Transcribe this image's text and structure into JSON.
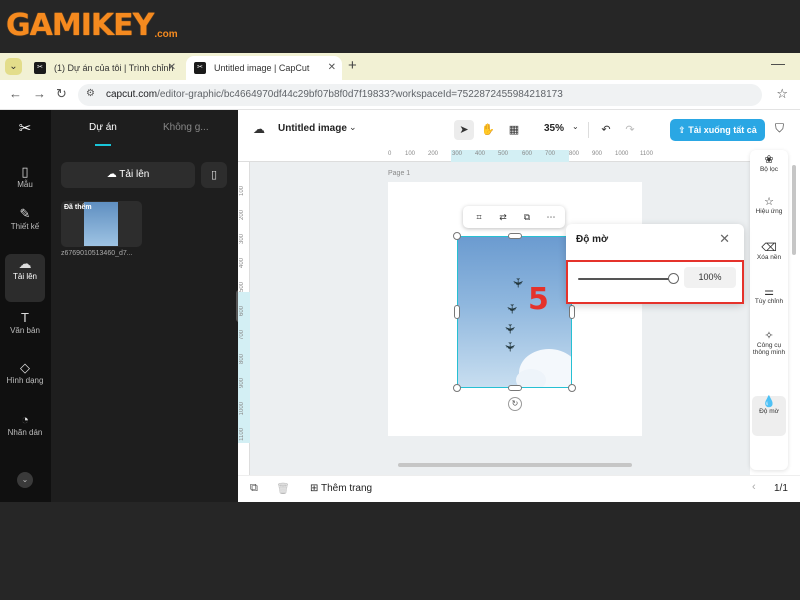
{
  "brand": {
    "name": "GAMIKEY",
    "suffix": ".com",
    "color": "#f58a1f"
  },
  "browser": {
    "tabs": [
      {
        "label": "(1) Dự án của tôi | Trình chỉnh",
        "active": false
      },
      {
        "label": "Untitled image | CapCut",
        "active": true
      }
    ],
    "url": {
      "host": "capcut.com",
      "path": "/editor-graphic/bc4664970df44c29bf07b8f0d7f19833?workspaceId=7522872455984218173"
    }
  },
  "rail": {
    "items": [
      {
        "icon": "template-icon",
        "label": "Mẫu"
      },
      {
        "icon": "design-icon",
        "label": "Thiết kế"
      },
      {
        "icon": "upload-cloud-icon",
        "label": "Tải lên",
        "active": true
      },
      {
        "icon": "text-icon",
        "label": "Văn bản"
      },
      {
        "icon": "shapes-icon",
        "label": "Hình dạng"
      },
      {
        "icon": "sticker-icon",
        "label": "Nhãn dán"
      }
    ]
  },
  "panel": {
    "tabs": [
      {
        "label": "Dự án",
        "active": true
      },
      {
        "label": "Không g..."
      }
    ],
    "upload_label": "Tải lên",
    "asset": {
      "tag": "Đã thêm",
      "filename": "z6769010513460_d7..."
    }
  },
  "topbar": {
    "title": "Untitled image",
    "zoom": "35%",
    "download_label": "Tải xuống tất cả"
  },
  "canvas": {
    "page_label": "Page 1",
    "ruler_top": [
      "0",
      "100",
      "200",
      "300",
      "400",
      "500",
      "600",
      "700",
      "800",
      "900",
      "1000",
      "1100"
    ],
    "ruler_left": [
      "100",
      "200",
      "300",
      "400",
      "500",
      "600",
      "700",
      "800",
      "900",
      "1000",
      "1100"
    ]
  },
  "opacity_panel": {
    "title": "Độ mờ",
    "value": "100%",
    "level": 1.0,
    "step": "5",
    "highlight_color": "#e5322b"
  },
  "right_rail": {
    "items": [
      {
        "icon": "filter-icon",
        "label": "Bộ lọc"
      },
      {
        "icon": "effects-icon",
        "label": "Hiệu ứng"
      },
      {
        "icon": "remove-bg-icon",
        "label": "Xóa nền"
      },
      {
        "icon": "adjust-icon",
        "label": "Tùy chỉnh"
      },
      {
        "icon": "smart-tools-icon",
        "label": "Công cụ thông minh"
      },
      {
        "icon": "opacity-icon",
        "label": "Độ mờ",
        "active": true
      }
    ]
  },
  "bottombar": {
    "add_page_label": "Thêm trang",
    "page_count": "1/1"
  },
  "colors": {
    "accent": "#26c0d3",
    "download": "#2aa7e4"
  }
}
